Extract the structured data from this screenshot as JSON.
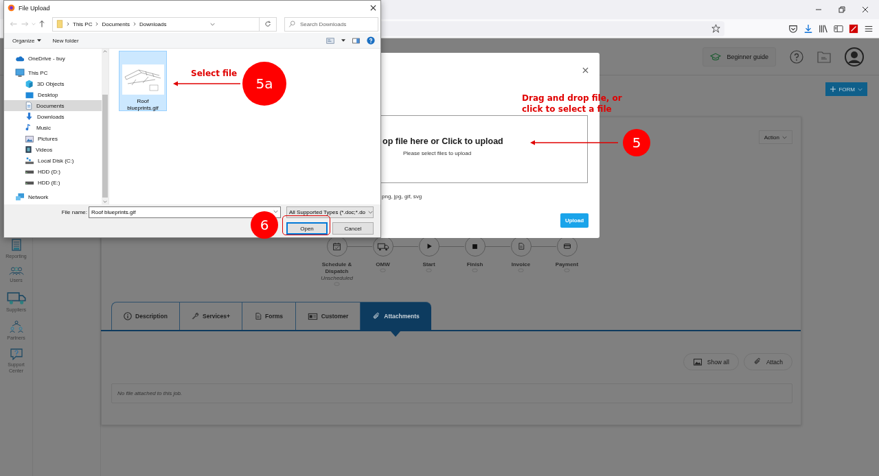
{
  "file_dialog": {
    "title": "File Upload",
    "breadcrumb": [
      "This PC",
      "Documents",
      "Downloads"
    ],
    "search": {
      "placeholder": "Search Downloads"
    },
    "toolbar": [
      {
        "label": "Organize",
        "dropdown": true
      },
      {
        "label": "New folder",
        "dropdown": false
      }
    ],
    "nav_tree": [
      {
        "label": "OneDrive - buy",
        "kind": "cloud",
        "selected": false
      },
      {
        "label": "This PC",
        "kind": "pc",
        "selected": false,
        "children": [
          {
            "label": "3D Objects",
            "kind": "cube",
            "selected": false
          },
          {
            "label": "Desktop",
            "kind": "desktop",
            "selected": false
          },
          {
            "label": "Documents",
            "kind": "documents",
            "selected": true
          },
          {
            "label": "Downloads",
            "kind": "download",
            "selected": false
          },
          {
            "label": "Music",
            "kind": "music",
            "selected": false
          },
          {
            "label": "Pictures",
            "kind": "pictures",
            "selected": false
          },
          {
            "label": "Videos",
            "kind": "videos",
            "selected": false
          },
          {
            "label": "Local Disk (C:)",
            "kind": "disk",
            "selected": false
          },
          {
            "label": "HDD (D:)",
            "kind": "drive",
            "selected": false
          },
          {
            "label": "HDD (E:)",
            "kind": "drive",
            "selected": false
          }
        ]
      },
      {
        "label": "Network",
        "kind": "network",
        "selected": false
      }
    ],
    "files": [
      {
        "name": "Roof blueprints.gif",
        "selected": true
      }
    ],
    "file_name": {
      "label": "File name:",
      "value": "Roof blueprints.gif"
    },
    "file_type": "All Supported Types (*.doc;*.do",
    "buttons": [
      {
        "label": "Open",
        "default": true
      },
      {
        "label": "Cancel",
        "default": false
      }
    ]
  },
  "app": {
    "guide_button": "Beginner guide",
    "form_button": "FORM",
    "sidebar": [
      {
        "label": "Reporting",
        "kind": "report"
      },
      {
        "label": "Users",
        "kind": "users"
      },
      {
        "label": "Suppliers",
        "kind": "truck"
      },
      {
        "label": "Partners",
        "kind": "partners"
      },
      {
        "label": "Support Center",
        "kind": "support"
      }
    ],
    "job_card": {
      "action_button": "Action",
      "workflow": [
        {
          "label": "Schedule & Dispatch",
          "status": "Unscheduled",
          "kind": "calendar"
        },
        {
          "label": "OMW",
          "kind": "truck"
        },
        {
          "label": "Start",
          "kind": "play"
        },
        {
          "label": "Finish",
          "kind": "stop"
        },
        {
          "label": "Invoice",
          "kind": "document"
        },
        {
          "label": "Payment",
          "kind": "card"
        }
      ],
      "tabs": [
        {
          "label": "Description",
          "kind": "info",
          "selected": false
        },
        {
          "label": "Services+",
          "kind": "wrench",
          "selected": false
        },
        {
          "label": "Forms",
          "kind": "document",
          "selected": false
        },
        {
          "label": "Customer",
          "kind": "idcard",
          "selected": false
        },
        {
          "label": "Attachments",
          "kind": "clip",
          "selected": true
        }
      ],
      "buttons": [
        {
          "label": "Show all",
          "kind": "image"
        },
        {
          "label": "Attach",
          "kind": "clip"
        }
      ],
      "empty_message": "No file attached to this job."
    }
  },
  "upload_modal": {
    "dropzone_title": "op file here or Click to upload",
    "dropzone_hint": "Please select files to upload",
    "allowed_types": "png, jpg, gif, svg",
    "upload_button": "Upload"
  },
  "annotations": [
    {
      "step": "5a",
      "note": "Select file"
    },
    {
      "step": "5",
      "note": "Drag and drop file, or click to select a file"
    },
    {
      "step": "6"
    }
  ]
}
